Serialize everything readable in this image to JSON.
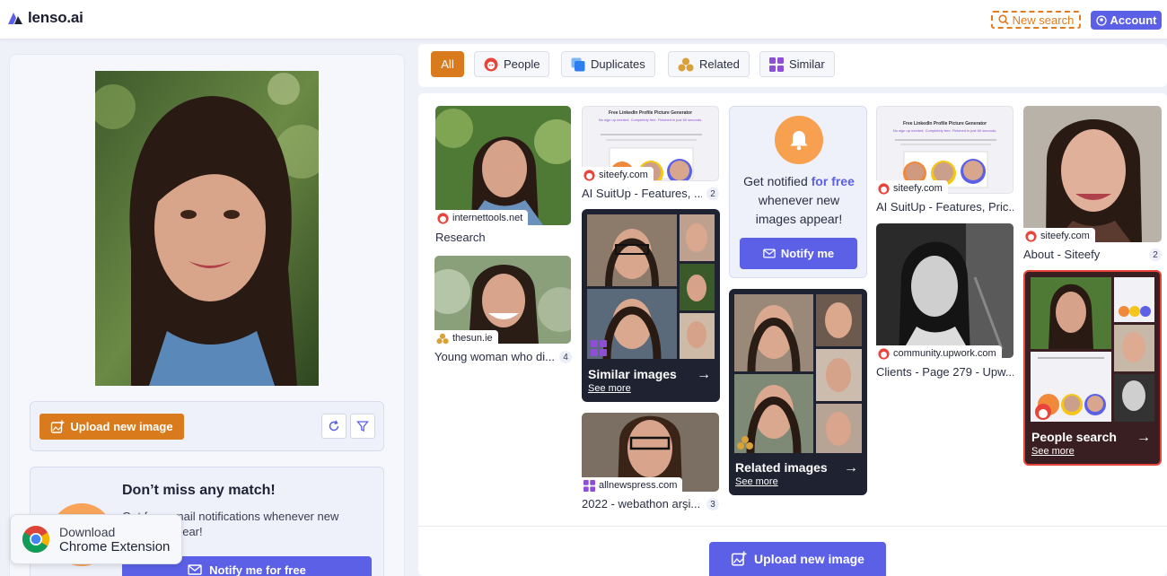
{
  "header": {
    "logo_text": "lenso.ai",
    "new_search_label": "New search",
    "account_label": "Account"
  },
  "left": {
    "upload_label": "Upload new image",
    "promo_title": "Don’t miss any match!",
    "promo_text": "Get free email notifications whenever new images appear!",
    "promo_button": "Notify me for free",
    "extension_line1": "Download",
    "extension_line2": "Chrome Extension"
  },
  "filters": [
    {
      "label": "All",
      "active": true
    },
    {
      "label": "People",
      "active": false
    },
    {
      "label": "Duplicates",
      "active": false
    },
    {
      "label": "Related",
      "active": false
    },
    {
      "label": "Similar",
      "active": false
    }
  ],
  "results": {
    "r1": {
      "source": "internettools.net",
      "caption": "Research"
    },
    "r2": {
      "source": "thesun.ie",
      "caption": "Young woman who di...",
      "count": "4"
    },
    "r3": {
      "source": "siteefy.com",
      "caption": "AI SuitUp - Features, ...",
      "count": "2"
    },
    "r4": {
      "title": "Similar images",
      "link": "See more"
    },
    "r5": {
      "source": "allnewspress.com",
      "caption": "2022 - webathon arşi...",
      "count": "3"
    },
    "r6": {
      "title": "Related images",
      "link": "See more"
    },
    "r7": {
      "source": "siteefy.com",
      "caption": "AI SuitUp - Features, Pric..."
    },
    "r8": {
      "source": "community.upwork.com",
      "caption": "Clients - Page 279 - Upw..."
    },
    "r9": {
      "source": "siteefy.com",
      "caption": "About - Siteefy",
      "count": "2"
    },
    "r10": {
      "title": "People search",
      "link": "See more"
    }
  },
  "notify_card": {
    "text_before": "Get notified ",
    "text_highlight": "for free",
    "text_after": " whenever new images appear!",
    "button": "Notify me"
  },
  "mini_page": {
    "heading": "Free LinkedIn Profile Picture Generator",
    "subheading": "No sign up needed. Completely free. Finished in just 60 seconds."
  },
  "bottom_upload_label": "Upload new image",
  "colors": {
    "accent_orange": "#d97a1c",
    "accent_purple": "#5b60e6",
    "people_red": "#e8443a",
    "dark_card": "#1f2230"
  }
}
